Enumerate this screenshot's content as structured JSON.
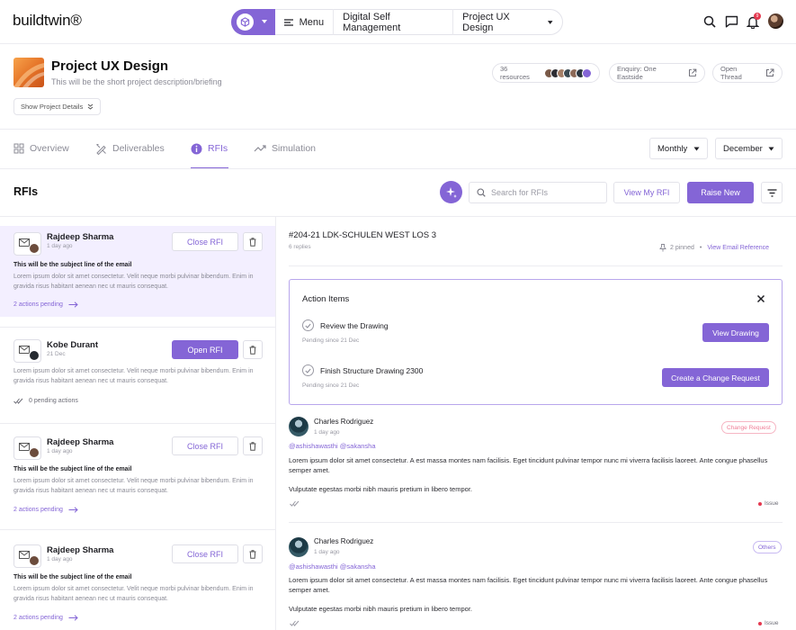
{
  "topbar": {
    "logo": "buildtwin®",
    "menu_label": "Menu",
    "workspace": "Digital Self Management",
    "project_switch": "Project UX Design",
    "notification_count": "9"
  },
  "project": {
    "title": "Project UX Design",
    "description": "This will be the short project description/briefing",
    "show_details_label": "Show Project Details",
    "resources_label": "36 resources",
    "enquiry_label": "Enquiry: One Eastside",
    "open_thread_label": "Open Thread"
  },
  "tabs": [
    {
      "label": "Overview",
      "icon": "grid-icon",
      "active": false
    },
    {
      "label": "Deliverables",
      "icon": "pencil-ruler-icon",
      "active": false
    },
    {
      "label": "RFIs",
      "icon": "info-icon",
      "active": true
    },
    {
      "label": "Simulation",
      "icon": "trend-icon",
      "active": false
    }
  ],
  "filters": {
    "period": "Monthly",
    "month": "December"
  },
  "rfis_header": {
    "title": "RFIs",
    "search_placeholder": "Search for RFIs",
    "view_my_rfi": "View My RFI",
    "raise_new": "Raise New"
  },
  "rfi_list": [
    {
      "name": "Rajdeep Sharma",
      "date": "1 day ago",
      "action": "Close RFI",
      "subject": "This will be the subject line of the email",
      "body": "Lorem ipsum dolor sit amet consectetur. Velit neque morbi pulvinar bibendum. Enim in gravida risus habitant aenean nec ut mauris consequat.",
      "pending": "2 actions pending"
    },
    {
      "name": "Kobe Durant",
      "date": "21 Dec",
      "action": "Open RFI",
      "body": "Lorem ipsum dolor sit amet consectetur. Velit neque morbi pulvinar bibendum. Enim in gravida risus habitant aenean nec ut mauris consequat.",
      "pending": "0 pending actions"
    },
    {
      "name": "Rajdeep Sharma",
      "date": "1 day ago",
      "action": "Close RFI",
      "subject": "This will be the subject line of the email",
      "body": "Lorem ipsum dolor sit amet consectetur. Velit neque morbi pulvinar bibendum. Enim in gravida risus habitant aenean nec ut mauris consequat.",
      "pending": "2 actions pending"
    },
    {
      "name": "Rajdeep Sharma",
      "date": "1 day ago",
      "action": "Close RFI",
      "subject": "This will be the subject line of the email",
      "body": "Lorem ipsum dolor sit amet consectetur. Velit neque morbi pulvinar bibendum. Enim in gravida risus habitant aenean nec ut mauris consequat.",
      "pending": "2 actions pending"
    }
  ],
  "thread": {
    "title": "#204-21 LDK-SCHULEN WEST LOS 3",
    "replies": "6 replies",
    "pinned": "2 pinned",
    "separator": "•",
    "email_reference": "View Email Reference"
  },
  "action_items": {
    "title": "Action Items",
    "items": [
      {
        "label": "Review the Drawing",
        "pending": "Pending since 21 Dec",
        "button": "View Drawing"
      },
      {
        "label": "Finish Structure Drawing 2300",
        "pending": "Pending since 21 Dec",
        "button": "Create a Change Request"
      }
    ]
  },
  "comments": [
    {
      "name": "Charles Rodriguez",
      "date": "1 day ago",
      "mentions": "@ashishawasthi  @sakansha",
      "body1": "Lorem ipsum dolor sit amet consectetur. A est massa montes nam facilisis. Eget tincidunt pulvinar tempor nunc mi viverra facilisis laoreet. Ante congue phasellus semper amet.",
      "body2": "Vulputate egestas morbi nibh mauris pretium in libero tempor.",
      "tag": "Change Request",
      "status": "Issue"
    },
    {
      "name": "Charles Rodriguez",
      "date": "1 day ago",
      "mentions": "@ashishawasthi  @sakansha",
      "body1": "Lorem ipsum dolor sit amet consectetur. A est massa montes nam facilisis. Eget tincidunt pulvinar tempor nunc mi viverra facilisis laoreet. Ante congue phasellus semper amet.",
      "body2": "Vulputate egestas morbi nibh mauris pretium in libero tempor.",
      "tag": "Others",
      "status": "Issue"
    }
  ],
  "colors": {
    "accent": "#8465d6",
    "change_request": "#f07d96",
    "issue": "#e53950"
  }
}
